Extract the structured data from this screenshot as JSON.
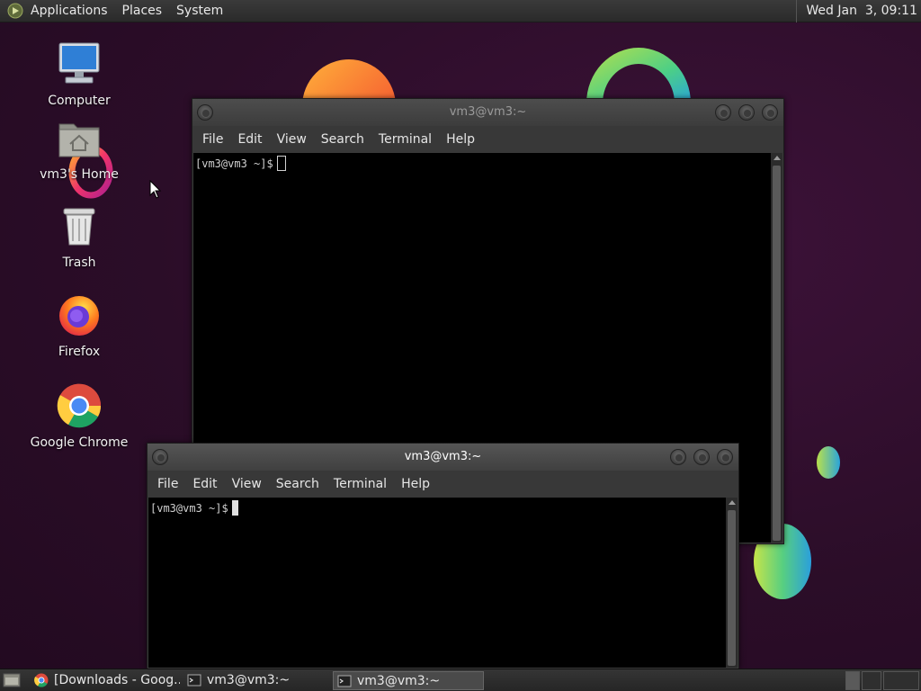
{
  "top_panel": {
    "menus": [
      "Applications",
      "Places",
      "System"
    ],
    "clock": "Wed Jan  3, 09:11"
  },
  "desktop_icons": [
    {
      "label": "Computer",
      "icon": "computer-icon"
    },
    {
      "label": "vm3's Home",
      "icon": "home-folder-icon"
    },
    {
      "label": "Trash",
      "icon": "trash-icon"
    },
    {
      "label": "Firefox",
      "icon": "firefox-icon"
    },
    {
      "label": "Google Chrome",
      "icon": "chrome-icon"
    }
  ],
  "terminals": [
    {
      "title": "vm3@vm3:~",
      "menus": [
        "File",
        "Edit",
        "View",
        "Search",
        "Terminal",
        "Help"
      ],
      "prompt": "[vm3@vm3 ~]$"
    },
    {
      "title": "vm3@vm3:~",
      "menus": [
        "File",
        "Edit",
        "View",
        "Search",
        "Terminal",
        "Help"
      ],
      "prompt": "[vm3@vm3 ~]$"
    }
  ],
  "taskbar": {
    "tasks": [
      {
        "label": "[Downloads - Goog...",
        "icon": "chrome-icon"
      },
      {
        "label": "vm3@vm3:~",
        "icon": "terminal-icon"
      },
      {
        "label": "vm3@vm3:~",
        "icon": "terminal-icon",
        "active": true
      }
    ]
  },
  "colors": {
    "wallpaper": "#2b0d28",
    "panel": "#2a2a2a",
    "terminal_bg": "#000000",
    "terminal_text": "#d0d0d0"
  }
}
